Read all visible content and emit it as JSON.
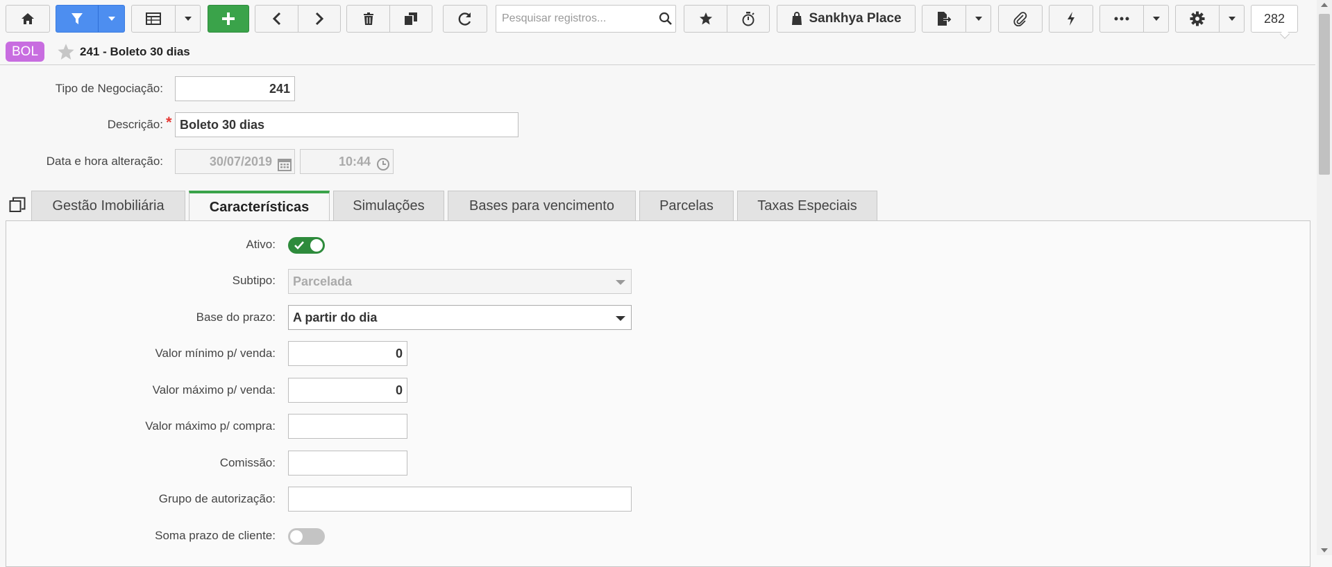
{
  "toolbar": {
    "search_placeholder": "Pesquisar registros...",
    "place_label": "Sankhya Place",
    "record_count": "282"
  },
  "record": {
    "badge": "BOL",
    "title": "241 - Boleto 30 dias",
    "badge_color": "#c86de0"
  },
  "header_form": {
    "tipo_label": "Tipo de Negociação:",
    "tipo_value": "241",
    "descricao_label": "Descrição:",
    "descricao_value": "Boleto 30 dias",
    "required_mark": "*",
    "data_label": "Data e hora alteração:",
    "data_value": "30/07/2019",
    "hora_value": "10:44"
  },
  "tabs": [
    {
      "label": "Gestão Imobiliária"
    },
    {
      "label": "Características"
    },
    {
      "label": "Simulações"
    },
    {
      "label": "Bases para vencimento"
    },
    {
      "label": "Parcelas"
    },
    {
      "label": "Taxas Especiais"
    }
  ],
  "active_tab": "Características",
  "form": {
    "ativo_label": "Ativo:",
    "subtipo_label": "Subtipo:",
    "subtipo_value": "Parcelada",
    "base_label": "Base do prazo:",
    "base_value": "A partir do dia",
    "vmin_venda_label": "Valor mínimo p/ venda:",
    "vmin_venda_value": "0",
    "vmax_venda_label": "Valor máximo p/ venda:",
    "vmax_venda_value": "0",
    "vmax_compra_label": "Valor máximo p/ compra:",
    "vmax_compra_value": "",
    "comissao_label": "Comissão:",
    "comissao_value": "",
    "grupo_label": "Grupo de autorização:",
    "grupo_value": "",
    "soma_label": "Soma prazo de cliente:"
  },
  "toggles": {
    "ativo": true,
    "soma_prazo": false
  },
  "colors": {
    "accent_blue": "#4d8ef0",
    "accent_green": "#3aa34a",
    "toggle_on": "#2e8b3c",
    "required": "#e53935"
  }
}
